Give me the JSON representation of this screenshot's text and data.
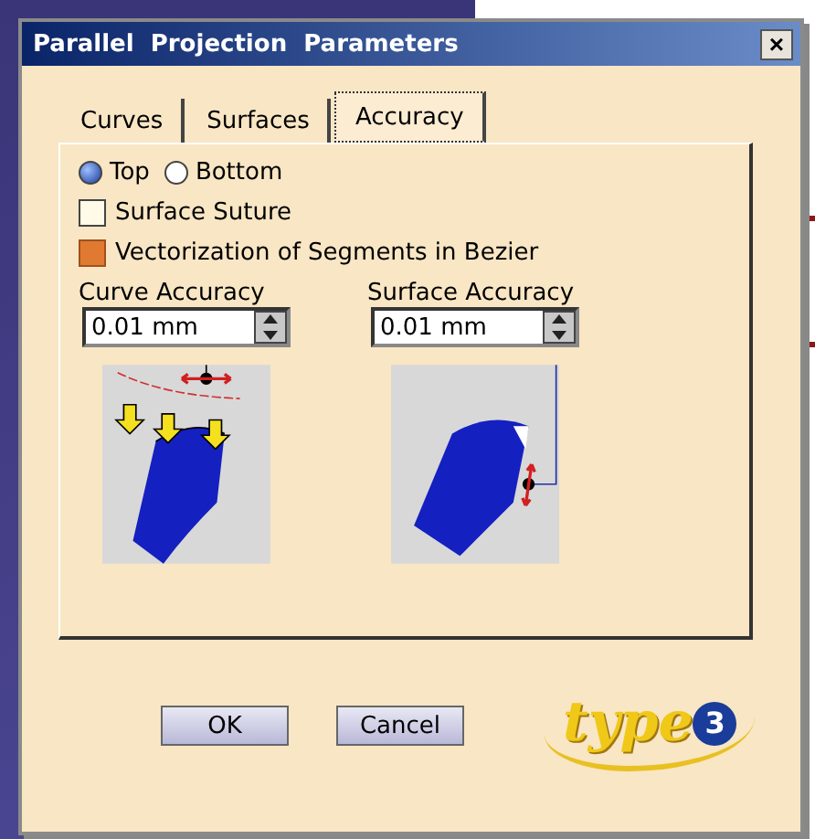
{
  "window": {
    "title": "Parallel  Projection  Parameters",
    "close": "×"
  },
  "tabs": [
    {
      "label": "Curves",
      "selected": false
    },
    {
      "label": "Surfaces",
      "selected": false
    },
    {
      "label": "Accuracy",
      "selected": true
    }
  ],
  "orientation": [
    {
      "label": "Top",
      "selected": true
    },
    {
      "label": "Bottom",
      "selected": false
    }
  ],
  "options": [
    {
      "label": "Surface Suture",
      "checked": false
    },
    {
      "label": "Vectorization of Segments in Bezier",
      "checked": true
    }
  ],
  "accuracy": [
    {
      "label": "Curve Accuracy",
      "value": "0.01 mm",
      "kind": "curve"
    },
    {
      "label": "Surface Accuracy",
      "value": "0.01 mm",
      "kind": "surface"
    }
  ],
  "buttons": [
    "OK",
    "Cancel"
  ],
  "logo": {
    "text": "type",
    "badge": "3"
  }
}
